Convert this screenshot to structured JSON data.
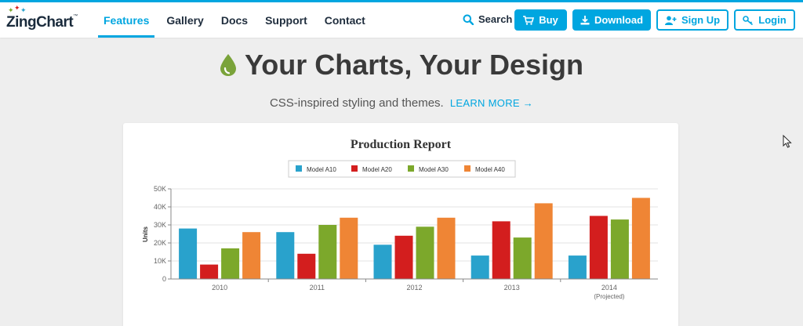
{
  "brand": {
    "name": "ZingChart",
    "tm": "™"
  },
  "nav": [
    {
      "label": "Features",
      "active": true
    },
    {
      "label": "Gallery",
      "active": false
    },
    {
      "label": "Docs",
      "active": false
    },
    {
      "label": "Support",
      "active": false
    },
    {
      "label": "Contact",
      "active": false
    }
  ],
  "header_actions": {
    "search_label": "Search",
    "buy_label": "Buy",
    "download_label": "Download",
    "signup_label": "Sign Up",
    "login_label": "Login"
  },
  "hero": {
    "title": "Your Charts, Your Design",
    "subtitle": "CSS-inspired styling and themes.",
    "link_label": "LEARN MORE →"
  },
  "colors": {
    "accent": "#00a6e0",
    "drop_icon": "#7aa33a",
    "page_bg": "#eeeeee"
  },
  "chart_data": {
    "type": "bar",
    "title": "Production Report",
    "ylabel": "Units",
    "xlabel": "",
    "ylim": [
      0,
      50000
    ],
    "yticks": [
      "0",
      "10K",
      "20K",
      "30K",
      "40K",
      "50K"
    ],
    "grid": true,
    "legend_position": "top-center",
    "categories": [
      {
        "label": "2010",
        "sublabel": ""
      },
      {
        "label": "2011",
        "sublabel": ""
      },
      {
        "label": "2012",
        "sublabel": ""
      },
      {
        "label": "2013",
        "sublabel": ""
      },
      {
        "label": "2014",
        "sublabel": "(Projected)"
      }
    ],
    "series": [
      {
        "name": "Model A10",
        "color": "#29a2cc",
        "values": [
          28000,
          26000,
          19000,
          13000,
          13000
        ]
      },
      {
        "name": "Model A20",
        "color": "#d31e1e",
        "values": [
          8000,
          14000,
          24000,
          32000,
          35000
        ]
      },
      {
        "name": "Model A30",
        "color": "#7ca82b",
        "values": [
          17000,
          30000,
          29000,
          23000,
          33000
        ]
      },
      {
        "name": "Model A40",
        "color": "#ef8535",
        "values": [
          26000,
          34000,
          34000,
          42000,
          45000
        ]
      }
    ]
  }
}
